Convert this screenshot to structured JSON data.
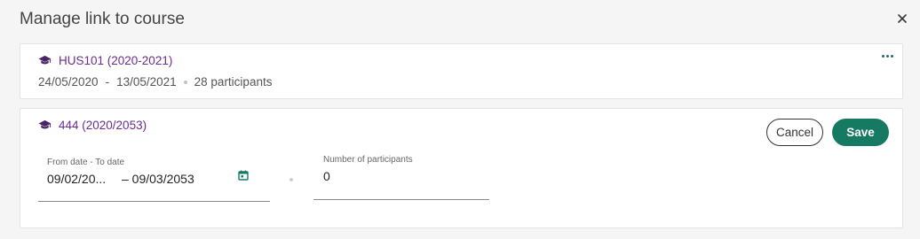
{
  "dialog": {
    "title": "Manage link to course",
    "close_icon": "close-icon"
  },
  "linked_course": {
    "icon": "graduation-cap-icon",
    "name": "HUS101 (2020-2021)",
    "start_date": "24/05/2020",
    "date_separator": "-",
    "end_date": "13/05/2021",
    "participants": "28 participants",
    "more_icon": "more-horizontal-icon"
  },
  "edit_course": {
    "icon": "graduation-cap-icon",
    "name": "444 (2020/2053)",
    "cancel_label": "Cancel",
    "save_label": "Save",
    "date_field": {
      "label": "From date - To date",
      "from_value": "09/02/20...",
      "to_value": "– 09/03/2053",
      "icon": "calendar-icon"
    },
    "participants_field": {
      "label": "Number of participants",
      "value": "0"
    }
  },
  "colors": {
    "course_link": "#6a2c8e",
    "save_button": "#167a63",
    "calendar_icon": "#167a63"
  }
}
